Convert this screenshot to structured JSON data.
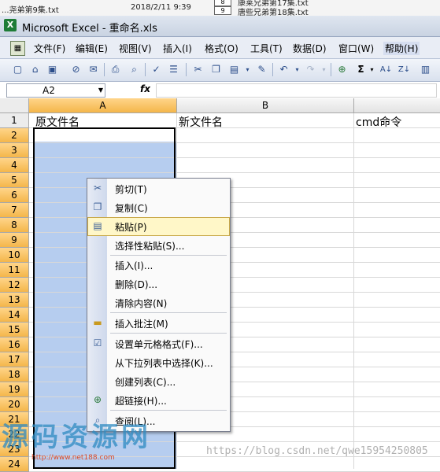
{
  "background_window": {
    "left_file": "...尧弟第9集.txt",
    "date": "2018/2/11 9:39",
    "rows": [
      {
        "num": "8",
        "name": "康莱兄弟第17集.txt"
      },
      {
        "num": "9",
        "name": "唐些兄弟第18集.txt"
      }
    ]
  },
  "window": {
    "title": "Microsoft Excel - 重命名.xls",
    "icon": "excel-icon"
  },
  "menubar": {
    "items": [
      "文件(F)",
      "编辑(E)",
      "视图(V)",
      "插入(I)",
      "格式(O)",
      "工具(T)",
      "数据(D)",
      "窗口(W)",
      "帮助(H)"
    ]
  },
  "toolbar": {
    "icons": [
      "new-icon",
      "open-icon",
      "save-icon",
      "permission-icon",
      "email-icon",
      "print-icon",
      "print-preview-icon",
      "spelling-icon",
      "research-icon",
      "cut-icon",
      "copy-icon",
      "paste-icon",
      "format-painter-icon",
      "undo-icon",
      "redo-icon",
      "hyperlink-icon",
      "autosum-icon",
      "sort-ascending-icon",
      "sort-descending-icon",
      "chart-wizard-icon"
    ]
  },
  "formula_bar": {
    "name_box": "A2",
    "fx": "fx",
    "formula": ""
  },
  "grid": {
    "columns": [
      "A",
      "B"
    ],
    "rows": [
      "1",
      "2",
      "3",
      "4",
      "5",
      "6",
      "7",
      "8",
      "9",
      "10",
      "11",
      "12",
      "13",
      "14",
      "15",
      "16",
      "17",
      "18",
      "19",
      "20",
      "21",
      "22",
      "23",
      "24"
    ],
    "row1": {
      "A": "原文件名",
      "B": "新文件名",
      "C": "cmd命令"
    },
    "selected_range": "A2:A24"
  },
  "context_menu": {
    "items": [
      {
        "label": "剪切(T)",
        "icon": "cut-icon"
      },
      {
        "label": "复制(C)",
        "icon": "copy-icon"
      },
      {
        "label": "粘贴(P)",
        "icon": "paste-icon",
        "highlighted": true
      },
      {
        "label": "选择性粘贴(S)...",
        "icon": ""
      },
      {
        "label": "插入(I)...",
        "icon": ""
      },
      {
        "label": "删除(D)...",
        "icon": ""
      },
      {
        "label": "清除内容(N)",
        "icon": ""
      },
      {
        "label": "插入批注(M)",
        "icon": "comment-icon"
      },
      {
        "label": "设置单元格格式(F)...",
        "icon": "format-cells-icon"
      },
      {
        "label": "从下拉列表中选择(K)...",
        "icon": ""
      },
      {
        "label": "创建列表(C)...",
        "icon": ""
      },
      {
        "label": "超链接(H)...",
        "icon": "hyperlink-icon"
      },
      {
        "label": "查阅(L)...",
        "icon": "lookup-icon"
      }
    ]
  },
  "watermark": {
    "main": "源码资源网",
    "small_url": "http://www.net188.com",
    "blog_url": "https://blog.csdn.net/qwe15954250805"
  },
  "colors": {
    "selection": "#b6cdef",
    "header_selected": "#f4b64a",
    "menu_highlight": "#fff7c8"
  }
}
